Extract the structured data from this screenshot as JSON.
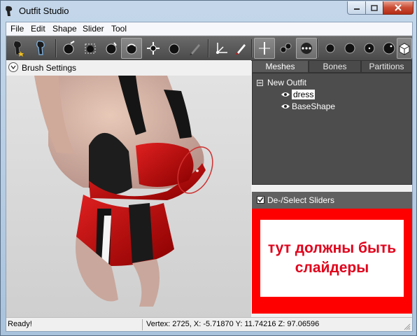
{
  "window": {
    "title": "Outfit Studio"
  },
  "menu": [
    "File",
    "Edit",
    "Shape",
    "Slider",
    "Tool"
  ],
  "toolbar": {
    "icons": [
      "select-icon",
      "mask-brush-icon",
      "inflate-brush-icon",
      "deflate-brush-icon",
      "move-brush-icon",
      "smooth-brush-icon",
      "transform-icon",
      "pose-brush-icon",
      "undiff-brush-icon",
      "weight-brush-icon",
      "translate-tool-icon",
      "paint-icon",
      "mirror-x-icon",
      "vertex-select-icon",
      "show-points-icon",
      "tiny-sphere-icon",
      "small-sphere-icon",
      "medium-sphere-icon",
      "large-sphere-icon",
      "shaded-view-icon"
    ]
  },
  "brush_settings": {
    "label": "Brush Settings"
  },
  "tabs": [
    {
      "label": "Meshes",
      "active": true
    },
    {
      "label": "Bones",
      "active": false
    },
    {
      "label": "Partitions",
      "active": false
    }
  ],
  "tree": {
    "root": "New Outfit",
    "items": [
      {
        "label": "dress",
        "selected": true
      },
      {
        "label": "BaseShape",
        "selected": false
      }
    ]
  },
  "sliders_panel": {
    "checkbox_label": "De-/Select Sliders",
    "checked": true,
    "annotation_line1": "тут должны быть",
    "annotation_line2": "слайдеры",
    "annotation_color": "#e0001a"
  },
  "status": {
    "left": "Ready!",
    "right": "Vertex: 2725, X: -5.71870 Y: 11.74216 Z: 97.06596"
  },
  "colors": {
    "accent_red": "#ff0000",
    "panel_dark": "#4d4d4d"
  }
}
